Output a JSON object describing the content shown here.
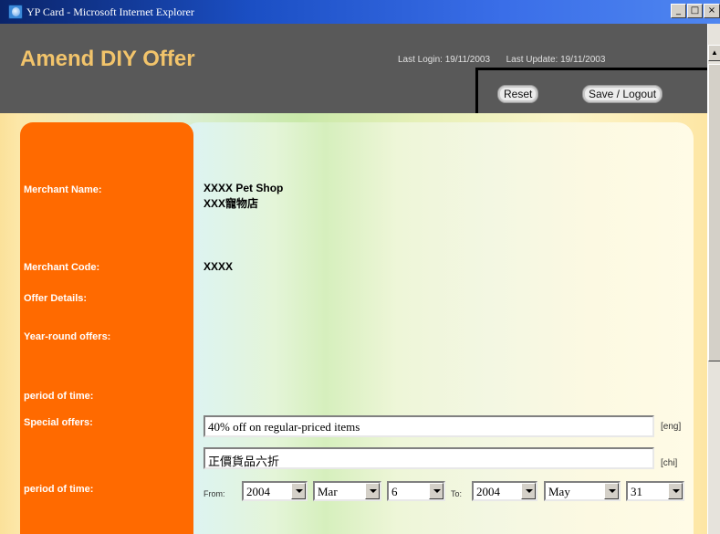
{
  "window": {
    "title": "YP Card - Microsoft Internet Explorer",
    "buttons": {
      "minimize": "_",
      "maximize": "□",
      "close": "×"
    }
  },
  "header": {
    "page_title": "Amend DIY Offer",
    "last_login_label": "Last Login:",
    "last_login_value": "19/11/2003",
    "last_update_label": "Last Update:",
    "last_update_value": "19/11/2003",
    "reset_label": "Reset",
    "save_logout_label": "Save / Logout"
  },
  "form": {
    "merchant_name_label": "Merchant Name:",
    "merchant_name_eng": "XXXX Pet Shop",
    "merchant_name_chi": "XXX寵物店",
    "merchant_code_label": "Merchant Code:",
    "merchant_code_value": "XXXX",
    "offer_details_label": "Offer Details:",
    "year_round_label": "Year-round offers:",
    "period_label_1": "period of time:",
    "special_offers_label": "Special offers:",
    "special_offer_eng": "40% off on regular-priced items",
    "lang_eng": "[eng]",
    "special_offer_chi": "正價貨品六折",
    "lang_chi": "[chi]",
    "period_label_2": "period of time:",
    "from_label": "From:",
    "to_label": "To:",
    "from_year": "2004",
    "from_month": "Mar",
    "from_day": "6",
    "to_year": "2004",
    "to_month": "May",
    "to_day": "31"
  },
  "colors": {
    "header_bg": "#595959",
    "title_accent": "#f2c46b",
    "sidebar_orange": "#ff6a00"
  }
}
